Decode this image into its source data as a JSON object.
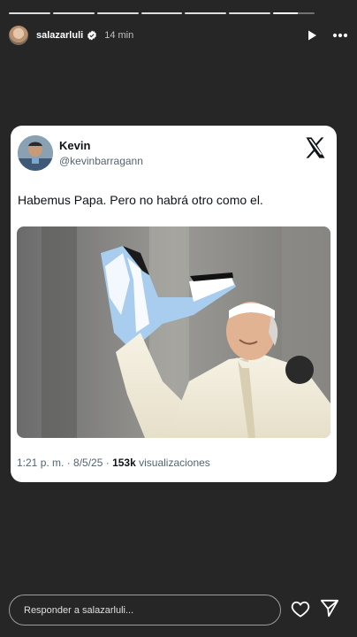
{
  "story": {
    "username": "salazarluli",
    "time_ago": "14 min",
    "progress_segments": 7,
    "reply_placeholder": "Responder a salazarluli..."
  },
  "tweet": {
    "display_name": "Kevin",
    "handle": "@kevinbarragann",
    "text": "Habemus Papa. Pero no habrá otro como el.",
    "time": "1:21 p. m. · 8/5/25 · ",
    "views_count": "153k",
    "views_label": " visualizaciones"
  },
  "icons": {
    "verified": "verified-badge-icon",
    "play": "play-icon",
    "more": "more-icon",
    "x_logo": "x-logo-icon",
    "heart": "heart-icon",
    "send": "send-icon"
  },
  "colors": {
    "background": "#262626",
    "card": "#ffffff",
    "muted_text": "#536471",
    "verified": "#ffffff"
  }
}
